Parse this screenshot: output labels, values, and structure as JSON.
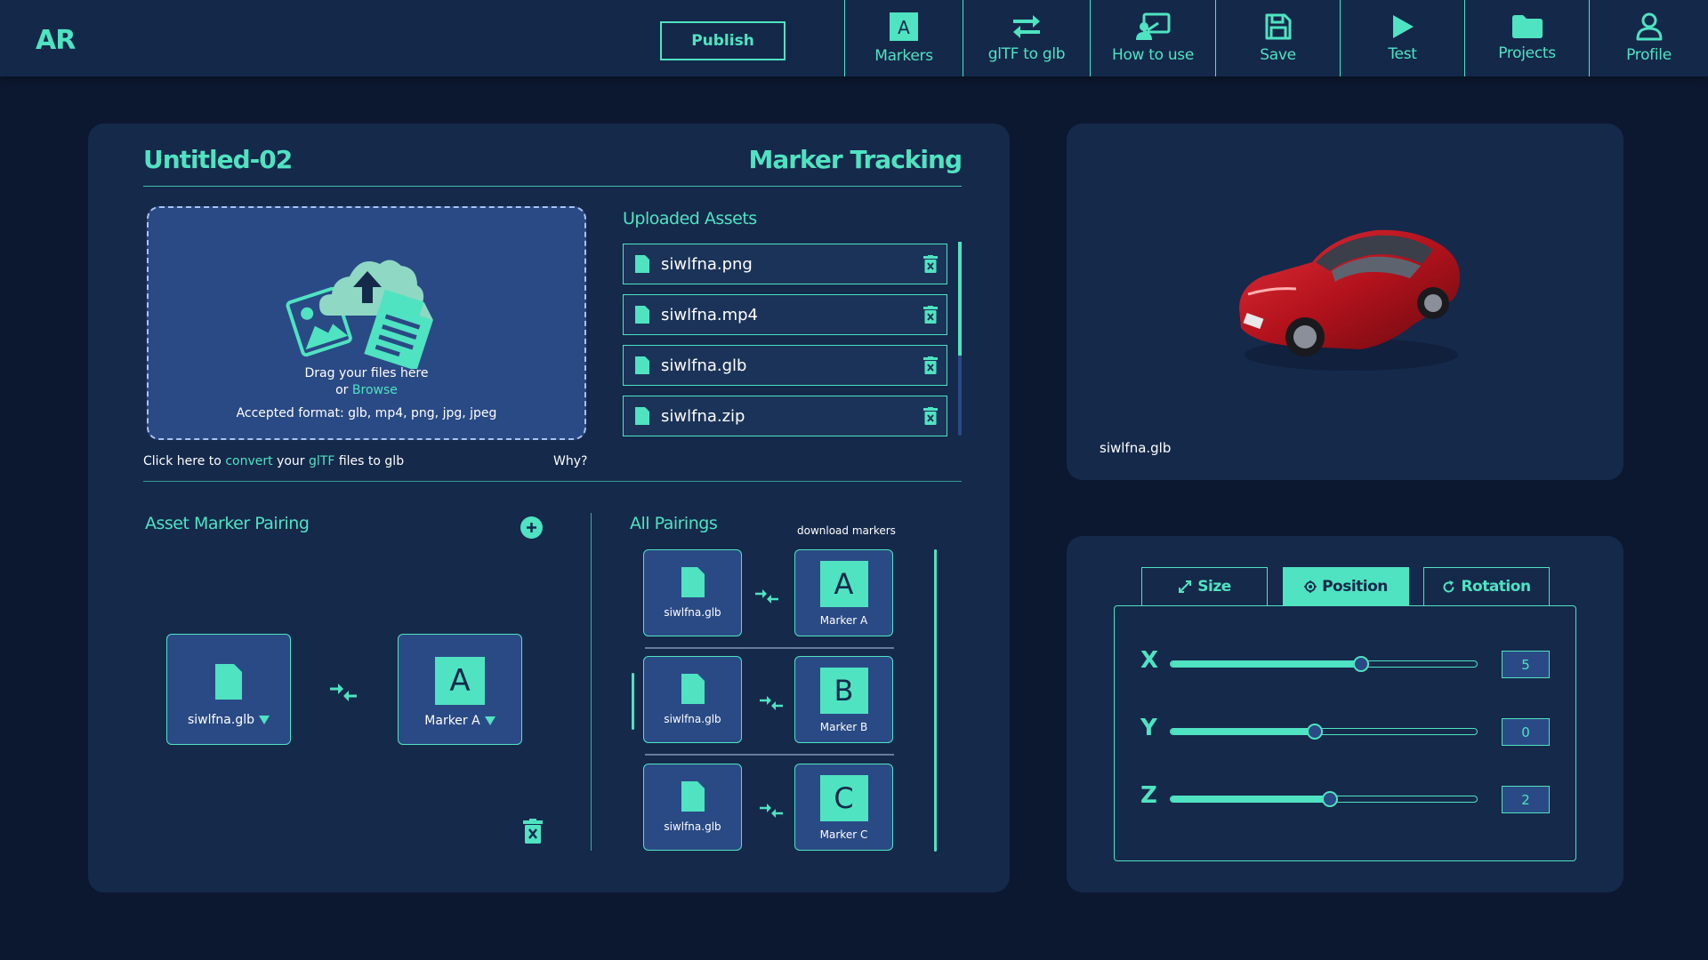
{
  "app": {
    "logo": "AR",
    "publish_label": "Publish"
  },
  "nav": [
    {
      "label": "Markers",
      "icon": "marker-a-icon"
    },
    {
      "label": "glTF to glb",
      "icon": "swap-arrows-icon"
    },
    {
      "label": "How to use",
      "icon": "presentation-icon"
    },
    {
      "label": "Save",
      "icon": "save-icon"
    },
    {
      "label": "Test",
      "icon": "play-icon"
    },
    {
      "label": "Projects",
      "icon": "folder-icon"
    },
    {
      "label": "Profile",
      "icon": "user-icon"
    }
  ],
  "project": {
    "title": "Untitled-02",
    "mode": "Marker Tracking"
  },
  "dropzone": {
    "line1": "Drag your files here",
    "or": "or",
    "browse": "Browse",
    "formats": "Accepted format: glb, mp4, png, jpg, jpeg"
  },
  "uploaded": {
    "title": "Uploaded Assets",
    "files": [
      "siwlfna.png",
      "siwlfna.mp4",
      "siwlfna.glb",
      "siwlfna.zip"
    ]
  },
  "convert": {
    "pre": "Click here to",
    "convert": "convert",
    "mid": "your",
    "gltf": "glTF",
    "post": "files to glb",
    "why": "Why?"
  },
  "pairing": {
    "title": "Asset Marker Pairing",
    "asset_label": "siwlfna.glb",
    "marker_letter": "A",
    "marker_label": "Marker A"
  },
  "all_pairings": {
    "title": "All Pairings",
    "download": "download markers",
    "items": [
      {
        "asset": "siwlfna.glb",
        "letter": "A",
        "marker": "Marker A"
      },
      {
        "asset": "siwlfna.glb",
        "letter": "B",
        "marker": "Marker B"
      },
      {
        "asset": "siwlfna.glb",
        "letter": "C",
        "marker": "Marker C"
      }
    ]
  },
  "preview": {
    "filename": "siwlfna.glb",
    "model_color": "#b3121c"
  },
  "controls": {
    "tabs": [
      {
        "label": "Size",
        "icon": "resize-icon"
      },
      {
        "label": "Position",
        "icon": "target-icon"
      },
      {
        "label": "Rotation",
        "icon": "rotate-icon"
      }
    ],
    "active_tab": "Position",
    "axes": [
      {
        "axis": "X",
        "value": "5",
        "level": 0.62
      },
      {
        "axis": "Y",
        "value": "0",
        "level": 0.47
      },
      {
        "axis": "Z",
        "value": "2",
        "level": 0.52
      }
    ]
  },
  "colors": {
    "accent": "#4fe3c1",
    "background": "#0c1830",
    "panel": "#15294b",
    "tile": "#2a4a85"
  }
}
